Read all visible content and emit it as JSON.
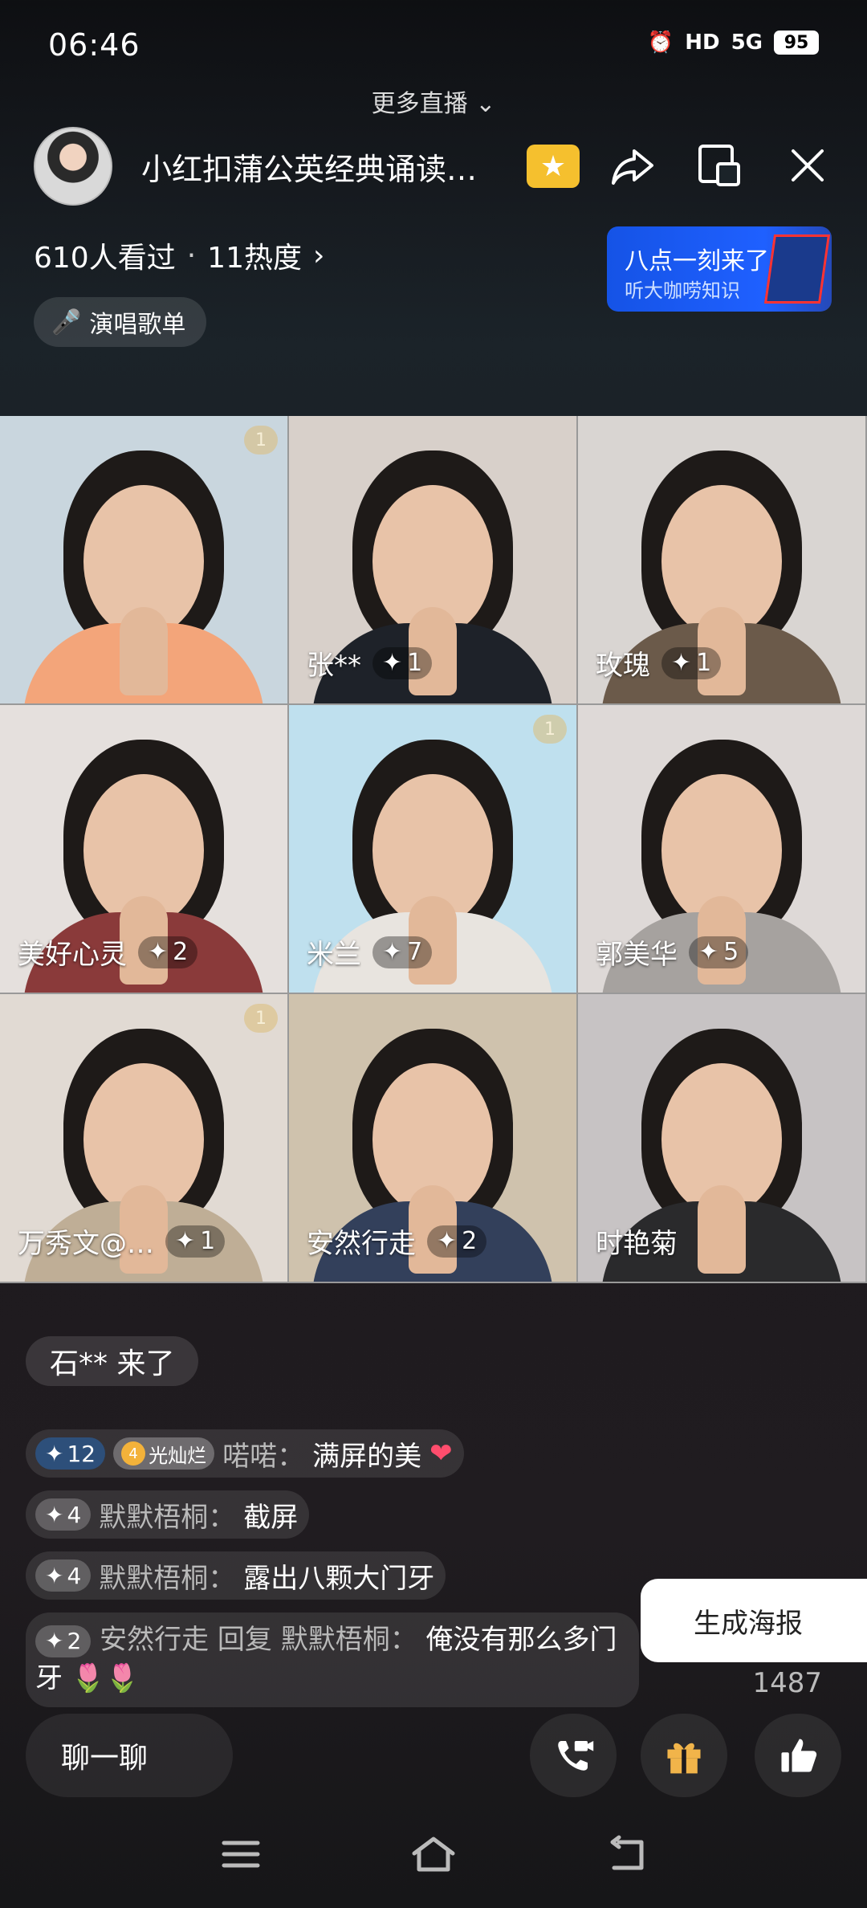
{
  "status": {
    "time": "06:46",
    "hd": "HD",
    "net": "5G",
    "battery": "95"
  },
  "more_live": "更多直播",
  "header": {
    "title": "小红扣蒲公英经典诵读…",
    "viewers": "610人看过",
    "dot": "·",
    "heat": "11热度"
  },
  "promo": {
    "title": "八点一刻来了",
    "subtitle": "听大咖唠知识"
  },
  "song_list": "演唱歌单",
  "tiles": [
    {
      "name": "",
      "level": "",
      "seat": "1",
      "bg": "#c9d6de",
      "torso": "#f3a57a"
    },
    {
      "name": "张**",
      "level": "1",
      "seat": "",
      "bg": "#d8d0ca",
      "torso": "#1e2229"
    },
    {
      "name": "玫瑰",
      "level": "1",
      "seat": "",
      "bg": "#d9d5d2",
      "torso": "#6b5a4a"
    },
    {
      "name": "美好心灵",
      "level": "2",
      "seat": "",
      "bg": "#e5e0dd",
      "torso": "#8a3a3a"
    },
    {
      "name": "米兰",
      "level": "7",
      "seat": "1",
      "bg": "#bfe0ee",
      "torso": "#e8e4df"
    },
    {
      "name": "郭美华",
      "level": "5",
      "seat": "",
      "bg": "#ded9d7",
      "torso": "#a6a29f"
    },
    {
      "name": "万秀文@…",
      "level": "1",
      "seat": "1",
      "bg": "#e1dad3",
      "torso": "#bfae96"
    },
    {
      "name": "安然行走",
      "level": "2",
      "seat": "",
      "bg": "#cfc2ad",
      "torso": "#33405b"
    },
    {
      "name": "时艳菊",
      "level": "",
      "seat": "",
      "bg": "#c7c3c4",
      "torso": "#2a2a2c"
    }
  ],
  "chat": {
    "join_notice": "石** 来了",
    "messages": [
      {
        "level": "12",
        "fan_badge": "光灿烂",
        "fan_level": "4",
        "user": "喏喏：",
        "text": "满屏的美"
      },
      {
        "level": "4",
        "user": "默默梧桐：",
        "text": "截屏"
      },
      {
        "level": "4",
        "user": "默默梧桐：",
        "text": "露出八颗大门牙"
      },
      {
        "level": "2",
        "user": "安然行走 回复 默默梧桐：",
        "text": "俺没有那么多门牙"
      }
    ]
  },
  "poster_button": "生成海报",
  "like_count": "1487",
  "chat_input": "聊一聊",
  "icons": [
    "more-live-chevron-icon",
    "star-badge-icon",
    "share-icon",
    "screen-icon",
    "close-icon",
    "microphone-icon",
    "video-call-icon",
    "gift-icon",
    "thumbs-up-icon",
    "nav-menu-icon",
    "nav-home-icon",
    "nav-back-icon"
  ]
}
